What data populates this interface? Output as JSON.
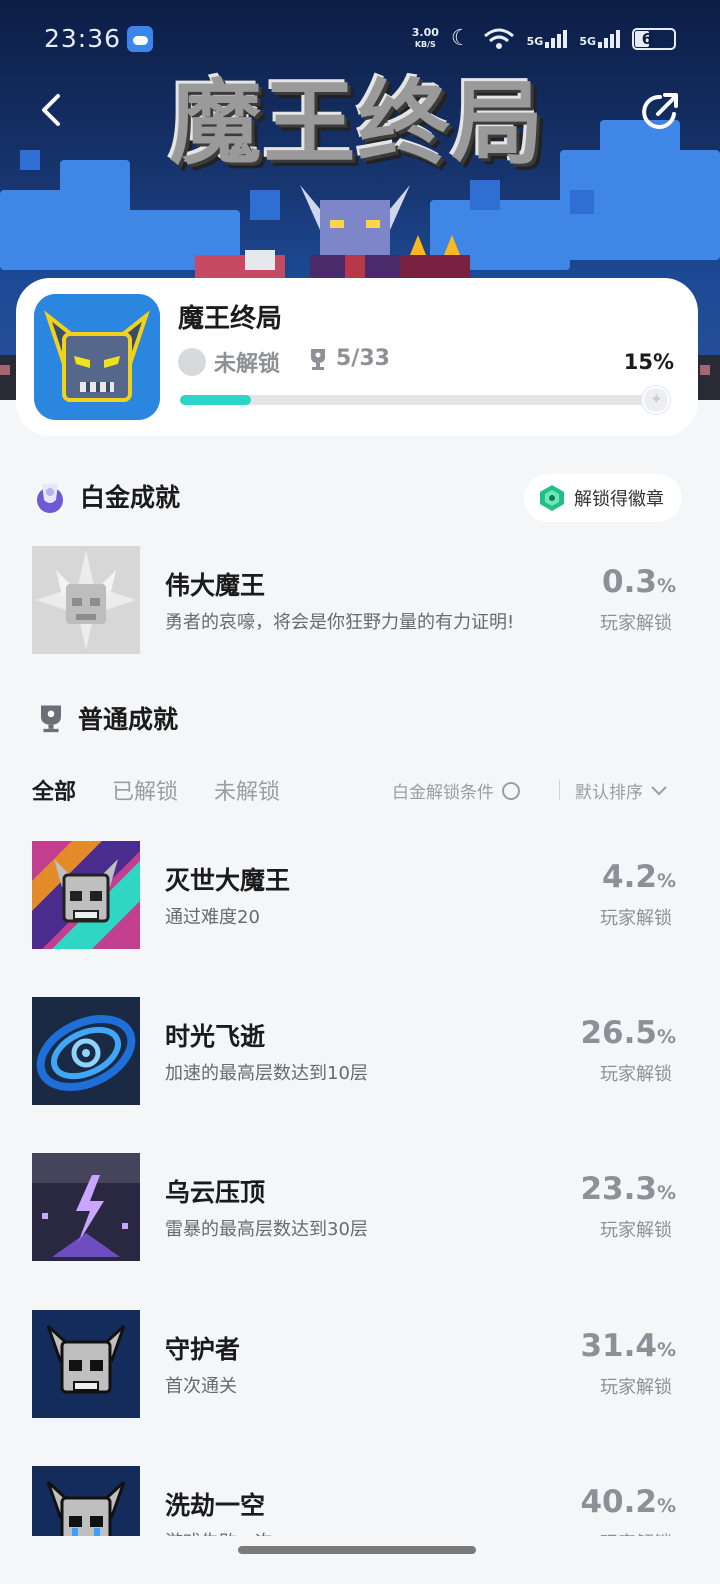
{
  "status_bar": {
    "time": "23:36",
    "speed": "3.00\nKB/S",
    "network1": "5G",
    "network2": "5G",
    "battery": "6"
  },
  "banner": {
    "logo_text": "魔王终局"
  },
  "game": {
    "name": "魔王终局",
    "lock_state": "未解锁",
    "trophy_count": "5/33",
    "progress_text": "15%",
    "progress": 0.15
  },
  "platinum": {
    "section_title": "白金成就",
    "badge_label": "解锁得徽章",
    "item": {
      "title": "伟大魔王",
      "desc": "勇者的哀嚎，将会是你狂野力量的有力证明!",
      "pct": "0.3",
      "pct_unit": "%",
      "pct_label": "玩家解锁"
    }
  },
  "normal": {
    "section_title": "普通成就",
    "tabs": [
      "全部",
      "已解锁",
      "未解锁"
    ],
    "filter_condition": "白金解锁条件",
    "sort_label": "默认排序",
    "items": [
      {
        "title": "灭世大魔王",
        "desc": "通过难度20",
        "pct": "4.2",
        "pct_unit": "%",
        "pct_label": "玩家解锁"
      },
      {
        "title": "时光飞逝",
        "desc": "加速的最高层数达到10层",
        "pct": "26.5",
        "pct_unit": "%",
        "pct_label": "玩家解锁"
      },
      {
        "title": "乌云压顶",
        "desc": "雷暴的最高层数达到30层",
        "pct": "23.3",
        "pct_unit": "%",
        "pct_label": "玩家解锁"
      },
      {
        "title": "守护者",
        "desc": "首次通关",
        "pct": "31.4",
        "pct_unit": "%",
        "pct_label": "玩家解锁"
      },
      {
        "title": "洗劫一空",
        "desc": "游戏失败一次",
        "pct": "40.2",
        "pct_unit": "%",
        "pct_label": "玩家解锁"
      }
    ]
  },
  "colors": {
    "accent": "#2bd6c8",
    "banner_dark": "#0c1d45",
    "page_bg": "#f5f6f8"
  }
}
